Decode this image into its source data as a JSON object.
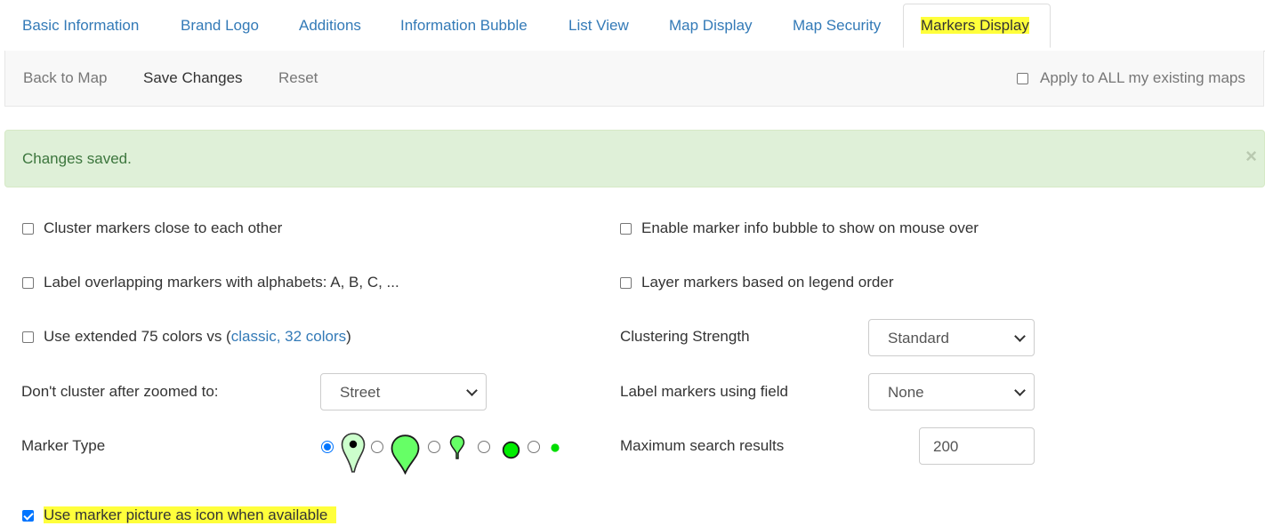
{
  "tabs": [
    {
      "label": "Basic Information"
    },
    {
      "label": "Brand Logo"
    },
    {
      "label": "Additions"
    },
    {
      "label": "Information Bubble"
    },
    {
      "label": "List View"
    },
    {
      "label": "Map Display"
    },
    {
      "label": "Map Security"
    },
    {
      "label": "Markers Display",
      "active": true
    }
  ],
  "toolbar": {
    "back_label": "Back to Map",
    "save_label": "Save Changes",
    "reset_label": "Reset",
    "apply_all_label": "Apply to ALL my existing maps",
    "apply_all_checked": false
  },
  "alert": {
    "message": "Changes saved.",
    "close_glyph": "×"
  },
  "options": {
    "cluster_markers": {
      "label": "Cluster markers close to each other",
      "checked": false
    },
    "enable_info_bubble": {
      "label": "Enable marker info bubble to show on mouse over",
      "checked": false
    },
    "label_overlapping": {
      "label": "Label overlapping markers with alphabets: A, B, C, ...",
      "checked": false
    },
    "layer_markers": {
      "label": "Layer markers based on legend order",
      "checked": false
    },
    "extended_colors": {
      "label_prefix": "Use extended 75 colors vs (",
      "link": "classic, 32 colors",
      "label_suffix": ")",
      "checked": false
    },
    "clustering_strength": {
      "label": "Clustering Strength",
      "value": "Standard"
    },
    "dont_cluster_zoom": {
      "label": "Don't cluster after zoomed to:",
      "value": "Street"
    },
    "label_markers_field": {
      "label": "Label markers using field",
      "value": "None"
    },
    "marker_type": {
      "label": "Marker Type",
      "selected_index": 0
    },
    "max_search_results": {
      "label": "Maximum search results",
      "value": "200"
    },
    "use_marker_picture": {
      "label": "Use marker picture as icon when available",
      "checked": true
    }
  },
  "colors": {
    "link": "#337ab7",
    "highlight": "#ffff3b",
    "alert_bg": "#dff0d8",
    "alert_text": "#3c763d",
    "marker_green": "#66ff66",
    "checkbox_blue": "#0075ff"
  }
}
